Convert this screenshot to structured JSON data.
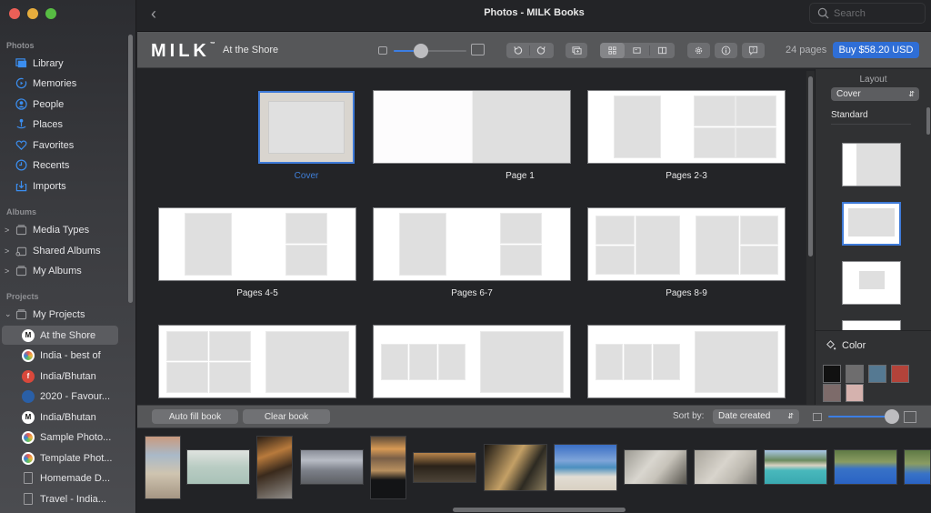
{
  "window": {
    "title": "Photos - MILK Books",
    "search_placeholder": "Search"
  },
  "sidebar": {
    "sections": {
      "photos": "Photos",
      "albums": "Albums",
      "projects": "Projects"
    },
    "photos_items": [
      {
        "label": "Library",
        "icon": "library-icon"
      },
      {
        "label": "Memories",
        "icon": "memories-icon"
      },
      {
        "label": "People",
        "icon": "people-icon"
      },
      {
        "label": "Places",
        "icon": "places-icon"
      },
      {
        "label": "Favorites",
        "icon": "heart-icon"
      },
      {
        "label": "Recents",
        "icon": "clock-icon"
      },
      {
        "label": "Imports",
        "icon": "import-icon"
      }
    ],
    "album_items": [
      {
        "label": "Media Types",
        "icon": "folder-icon"
      },
      {
        "label": "Shared Albums",
        "icon": "shared-folder-icon"
      },
      {
        "label": "My Albums",
        "icon": "folder-icon"
      }
    ],
    "projects_folder": "My Projects",
    "project_items": [
      {
        "label": "At the Shore",
        "badge": "M",
        "selected": true
      },
      {
        "label": "India - best of",
        "badge": ""
      },
      {
        "label": "India/Bhutan",
        "badge": "f"
      },
      {
        "label": "2020 - Favour...",
        "badge": ""
      },
      {
        "label": "India/Bhutan",
        "badge": "M"
      },
      {
        "label": "Sample Photo...",
        "badge": ""
      },
      {
        "label": "Template Phot...",
        "badge": ""
      },
      {
        "label": "Homemade D...",
        "badge": ""
      },
      {
        "label": "Travel - India...",
        "badge": ""
      }
    ]
  },
  "toolbar": {
    "logo": "MILK",
    "logo_tm": "™",
    "project_name": "At the Shore",
    "zoom_level": 0.38,
    "pages_count": "24 pages",
    "buy_label": "Buy $58.20 USD"
  },
  "canvas": {
    "cover_label": "Cover",
    "spreads": [
      {
        "label": "Page 1"
      },
      {
        "label": "Pages 2-3"
      },
      {
        "label": "Pages 4-5"
      },
      {
        "label": "Pages 6-7"
      },
      {
        "label": "Pages 8-9"
      }
    ]
  },
  "right_panel": {
    "title": "Layout",
    "layout_select": "Cover",
    "group_label": "Standard",
    "color_label": "Color",
    "swatches": [
      "#111111",
      "#6e6d6e",
      "#557992",
      "#b3433a",
      "#7d6b6a",
      "#d5b2ae"
    ]
  },
  "bottom_bar": {
    "auto_fill": "Auto fill book",
    "clear": "Clear book",
    "sort_label": "Sort by:",
    "sort_value": "Date created",
    "thumb_size": 0.97
  }
}
